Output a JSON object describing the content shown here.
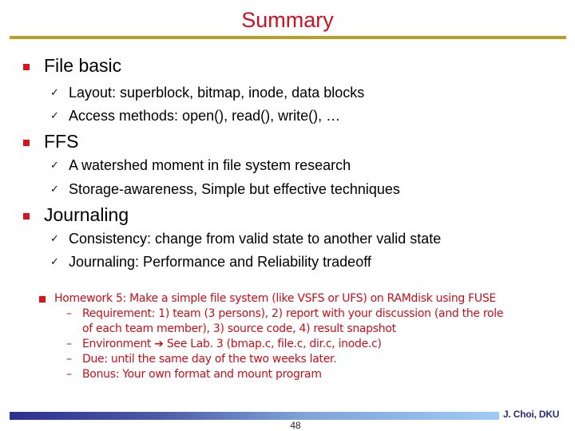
{
  "slide": {
    "title": "Summary",
    "sections": [
      {
        "heading": "File basic",
        "items": [
          "Layout: superblock, bitmap, inode, data blocks",
          "Access methods: open(), read(), write(), …"
        ]
      },
      {
        "heading": "FFS",
        "items": [
          "A watershed moment in file system research",
          "Storage-awareness, Simple but effective techniques"
        ]
      },
      {
        "heading": "Journaling",
        "items": [
          "Consistency: change from valid state to another valid state",
          "Journaling: Performance and Reliability tradeoff"
        ]
      }
    ],
    "bullet_glyph": "■",
    "check_glyph": "✓",
    "homework": {
      "heading": "Homework 5: Make a simple file system (like VSFS or UFS) on RAMdisk using FUSE",
      "dash_glyph": "–",
      "requirement_line1": "Requirement: 1) team (3 persons), 2) report with your discussion (and the role",
      "requirement_line2": "of each team member), 3) source code, 4) result snapshot",
      "environment_label": "Environment",
      "arrow_glyph": "➔",
      "environment_value": "See Lab. 3 (bmap.c, file.c, dir.c, inode.c)",
      "due": "Due: until the same day of the two weeks later.",
      "bonus": "Bonus: Your own format and mount program"
    },
    "footer": {
      "author": "J. Choi, DKU",
      "page_number": "48"
    },
    "colors": {
      "title": "#cc1122",
      "rule": "#b89e25",
      "bullet": "#e0101a",
      "homework_text": "#c4101a",
      "footer_bar_start": "#2e2f8f",
      "footer_bar_end": "#9fcbf7",
      "author": "#2a2a7a"
    }
  }
}
